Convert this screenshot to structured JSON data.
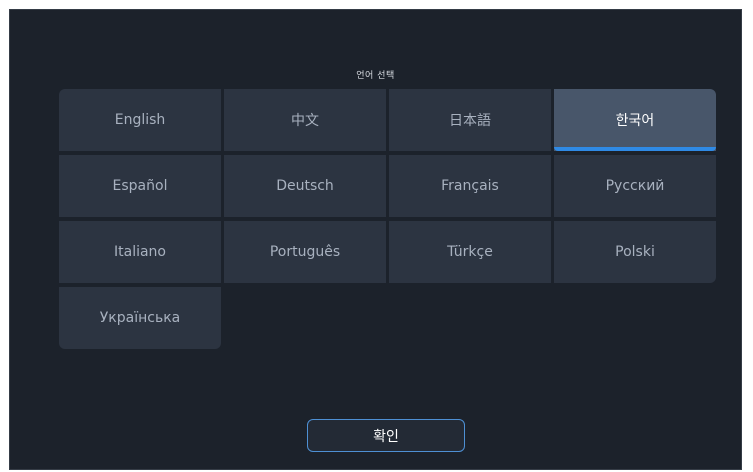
{
  "dialog": {
    "title": "언어 선택",
    "confirm_label": "확인"
  },
  "languages": [
    {
      "label": "English",
      "selected": false
    },
    {
      "label": "中文",
      "selected": false
    },
    {
      "label": "日本語",
      "selected": false
    },
    {
      "label": "한국어",
      "selected": true
    },
    {
      "label": "Español",
      "selected": false
    },
    {
      "label": "Deutsch",
      "selected": false
    },
    {
      "label": "Français",
      "selected": false
    },
    {
      "label": "Русский",
      "selected": false
    },
    {
      "label": "Italiano",
      "selected": false
    },
    {
      "label": "Português",
      "selected": false
    },
    {
      "label": "Türkçe",
      "selected": false
    },
    {
      "label": "Polski",
      "selected": false
    },
    {
      "label": "Українська",
      "selected": false
    }
  ],
  "colors": {
    "background": "#1c222b",
    "button": "#2c3441",
    "button_selected": "#48566a",
    "accent": "#2f8ae5"
  }
}
